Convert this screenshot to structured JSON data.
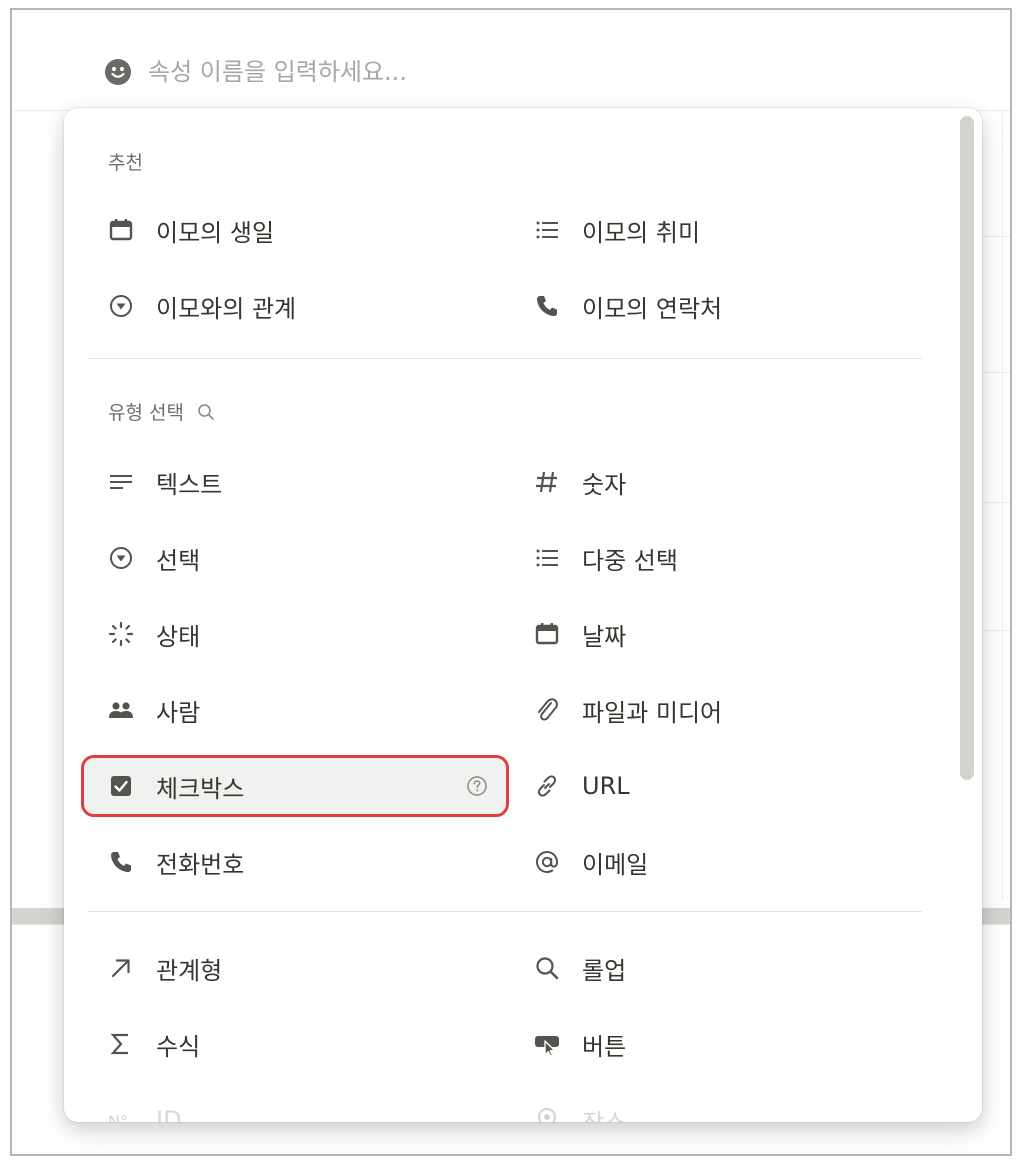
{
  "property_name": {
    "placeholder": "속성 이름을 입력하세요..."
  },
  "suggested": {
    "heading": "추천",
    "items": [
      {
        "icon": "calendar-icon",
        "label": "이모의 생일"
      },
      {
        "icon": "multi-select-list-icon",
        "label": "이모의 취미"
      },
      {
        "icon": "select-circle-icon",
        "label": "이모와의 관계"
      },
      {
        "icon": "phone-icon",
        "label": "이모의 연락처"
      }
    ]
  },
  "types": {
    "heading": "유형 선택",
    "items": [
      {
        "icon": "text-lines-icon",
        "label": "텍스트"
      },
      {
        "icon": "hash-icon",
        "label": "숫자"
      },
      {
        "icon": "select-circle-icon",
        "label": "선택"
      },
      {
        "icon": "multi-select-list-icon",
        "label": "다중 선택"
      },
      {
        "icon": "status-spinner-icon",
        "label": "상태"
      },
      {
        "icon": "calendar-icon",
        "label": "날짜"
      },
      {
        "icon": "people-icon",
        "label": "사람"
      },
      {
        "icon": "paperclip-icon",
        "label": "파일과 미디어"
      },
      {
        "icon": "checkbox-icon",
        "label": "체크박스",
        "selected": true
      },
      {
        "icon": "link-icon",
        "label": "URL"
      },
      {
        "icon": "phone-icon",
        "label": "전화번호"
      },
      {
        "icon": "at-sign-icon",
        "label": "이메일"
      }
    ]
  },
  "advanced": {
    "items": [
      {
        "icon": "arrow-up-right-icon",
        "label": "관계형"
      },
      {
        "icon": "magnifier-icon",
        "label": "롤업"
      },
      {
        "icon": "sigma-icon",
        "label": "수식"
      },
      {
        "icon": "cursor-click-icon",
        "label": "버튼"
      },
      {
        "icon": "number-id-icon",
        "label": "ID"
      },
      {
        "icon": "location-pin-icon",
        "label": "장소"
      }
    ]
  },
  "colors": {
    "selection_outline": "#e03e3e",
    "icon": "#55534e",
    "text": "#37352f",
    "muted": "#6f6e69"
  }
}
